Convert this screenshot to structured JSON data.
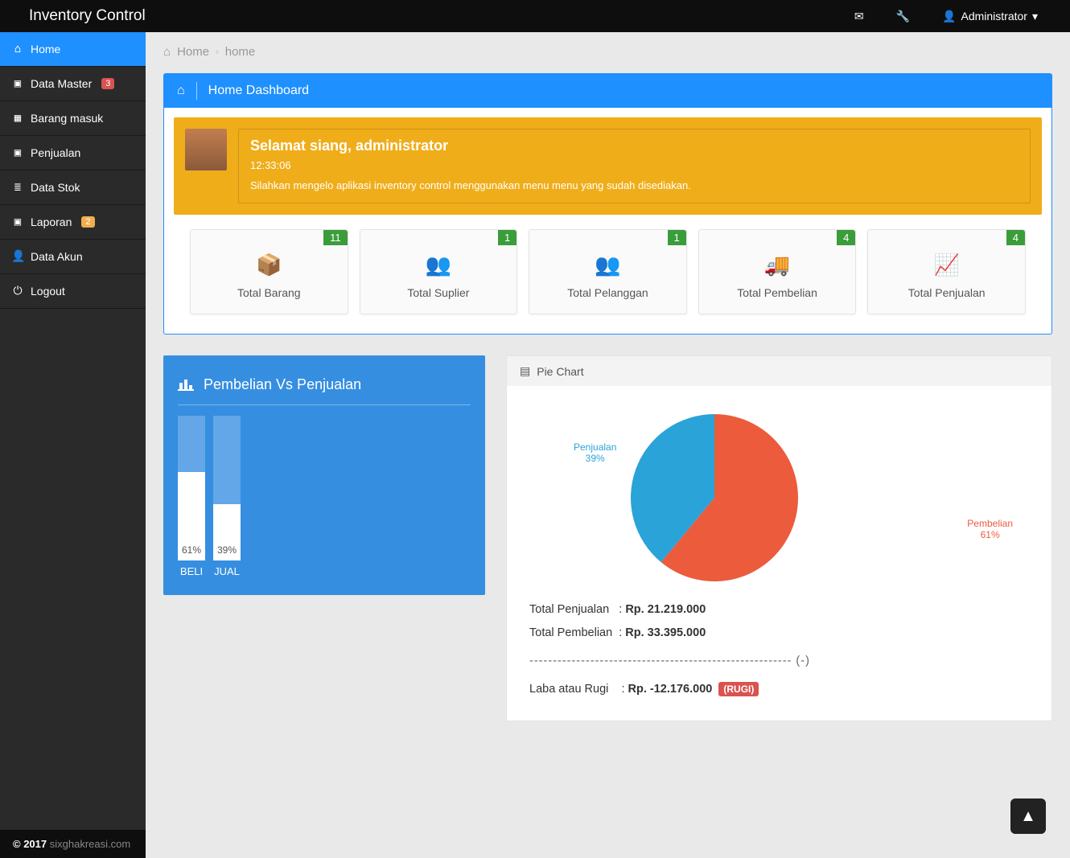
{
  "app": {
    "brand": "Inventory Control",
    "user": "Administrator"
  },
  "sidebar": {
    "items": [
      {
        "label": "Home",
        "badge": null,
        "active": true
      },
      {
        "label": "Data Master",
        "badge": "3",
        "active": false,
        "badge_style": "red"
      },
      {
        "label": "Barang masuk",
        "badge": null,
        "active": false
      },
      {
        "label": "Penjualan",
        "badge": null,
        "active": false
      },
      {
        "label": "Data Stok",
        "badge": null,
        "active": false
      },
      {
        "label": "Laporan",
        "badge": "2",
        "active": false,
        "badge_style": "orange"
      },
      {
        "label": "Data Akun",
        "badge": null,
        "active": false
      },
      {
        "label": "Logout",
        "badge": null,
        "active": false
      }
    ]
  },
  "breadcrumb": {
    "root": "Home",
    "leaf": "home"
  },
  "dashboard": {
    "title": "Home Dashboard",
    "welcome": {
      "greeting": "Selamat siang, administrator",
      "time": "12:33:06",
      "message": "Silahkan mengelo aplikasi inventory control menggunakan menu menu yang sudah disediakan."
    },
    "stats": [
      {
        "count": "11",
        "label": "Total Barang"
      },
      {
        "count": "1",
        "label": "Total Suplier"
      },
      {
        "count": "1",
        "label": "Total Pelanggan"
      },
      {
        "count": "4",
        "label": "Total Pembelian"
      },
      {
        "count": "4",
        "label": "Total Penjualan"
      }
    ],
    "bar_title": "Pembelian Vs Penjualan",
    "pie_title": "Pie Chart",
    "totals": {
      "penjualan_label": "Total Penjualan",
      "penjualan_value": "Rp. 21.219.000",
      "pembelian_label": "Total Pembelian",
      "pembelian_value": "Rp. 33.395.000",
      "dash": "-------------------------------------------------------- (-)",
      "laba_label": "Laba atau Rugi",
      "laba_value": "Rp. -12.176.000",
      "rugi_badge": "(RUGI)"
    }
  },
  "footer": {
    "year": "© 2017",
    "by": "sixghakreasi.com"
  },
  "chart_data": [
    {
      "type": "bar",
      "title": "Pembelian Vs Penjualan",
      "categories": [
        "BELI",
        "JUAL"
      ],
      "values": [
        61,
        39
      ],
      "ylabel": "%",
      "ylim": [
        0,
        100
      ]
    },
    {
      "type": "pie",
      "title": "Pie Chart",
      "series": [
        {
          "name": "Pembelian",
          "value": 61,
          "label": "Pembelian 61%",
          "color": "#eb5b3c"
        },
        {
          "name": "Penjualan",
          "value": 39,
          "label": "Penjualan 39%",
          "color": "#2aa3d8"
        }
      ]
    }
  ]
}
